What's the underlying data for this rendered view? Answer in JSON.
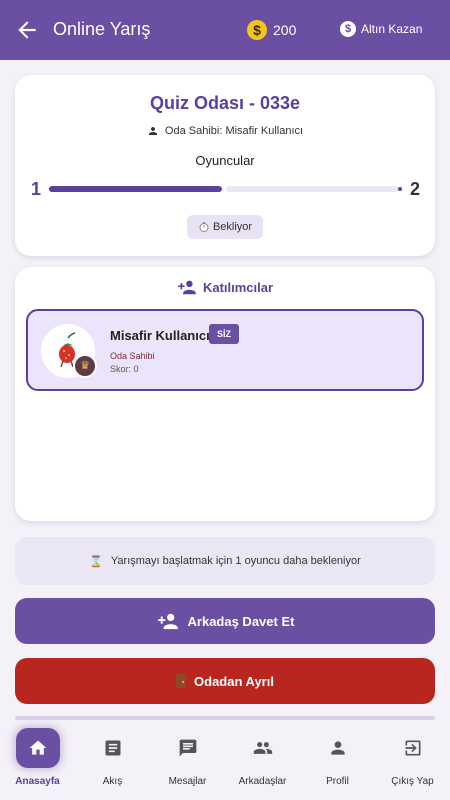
{
  "appbar": {
    "title": "Online Yarış",
    "coins": "200",
    "coin_symbol": "$",
    "earn_label": "Altın Kazan"
  },
  "room": {
    "title": "Quiz Odası - 033e",
    "owner_text": "Oda Sahibi: Misafir Kullanıcı",
    "players_label": "Oyuncular",
    "current_players": "1",
    "max_players": "2",
    "fill_fraction": 0.5,
    "status_label": "Bekliyor"
  },
  "participants": {
    "heading": "Katılımcılar",
    "list": [
      {
        "name": "Misafir Kullanıcı",
        "badge": "SİZ",
        "role": "Oda Sahibi",
        "score": "Skor: 0"
      }
    ]
  },
  "waiting": {
    "message": "Yarışmayı başlatmak için 1 oyuncu daha bekleniyor"
  },
  "actions": {
    "invite_label": "Arkadaş Davet Et",
    "leave_label": "Odadan Ayrıl"
  },
  "nav": {
    "items": [
      {
        "label": "Anasayfa",
        "icon": "home-icon",
        "active": true
      },
      {
        "label": "Akış",
        "icon": "feed-icon",
        "active": false
      },
      {
        "label": "Mesajlar",
        "icon": "messages-icon",
        "active": false
      },
      {
        "label": "Arkadaşlar",
        "icon": "friends-icon",
        "active": false
      },
      {
        "label": "Profil",
        "icon": "profile-icon",
        "active": false
      },
      {
        "label": "Çıkış Yap",
        "icon": "logout-icon",
        "active": false
      }
    ]
  },
  "colors": {
    "primary": "#6a4fa3",
    "danger": "#b8261f",
    "background": "#f4f1f8"
  }
}
